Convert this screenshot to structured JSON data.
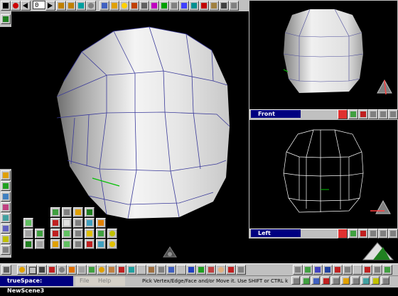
{
  "app": {
    "window_title": "trueSpace: NewScene3",
    "menu": [
      "File",
      "Help"
    ]
  },
  "toolbar": {
    "frame_value": "0"
  },
  "viewports": {
    "front_label": "Front",
    "left_label": "Left"
  },
  "status_text": "Pick Vertex/Edge/Face and/or Move it. Use SHIFT or CTRL key to add s",
  "colors": {
    "background": "#000000",
    "panel": "#c0c0c0",
    "title_bar": "#000080",
    "mesh_edges": "#3a3a9a",
    "selected_edge": "#00c000"
  },
  "icons": {
    "top_toolbar": [
      "stop-icon",
      "record-icon",
      "rewind-icon",
      "play-icon",
      "key-icon",
      "key-icon",
      "key-icon",
      "key-icon",
      "help-icon",
      "scene-icon",
      "eye-icon",
      "camera-icon",
      "light-icon",
      "render-icon",
      "object-icon",
      "material-icon",
      "paint-icon",
      "dots-icon",
      "grid-icon",
      "sync-icon",
      "undo-icon",
      "lock-icon",
      "view-icon",
      "arrow-icon",
      "delete-icon",
      "close-icon",
      "tool-icon",
      "tool-icon",
      "tool-icon",
      "tool-icon"
    ],
    "bottom_toolbar": [
      "object-tool-icon",
      "sphere-icon",
      "cube-icon",
      "cylinder-icon",
      "cone-icon",
      "torus-icon",
      "plane-icon",
      "text-icon",
      "paint-icon",
      "material-icon",
      "light-icon",
      "camera-icon",
      "render-icon",
      "deform-icon",
      "sweep-icon",
      "tip-icon",
      "lathe-icon",
      "bevel-icon",
      "smooth-icon",
      "boolean-icon",
      "grid-icon",
      "axis-icon",
      "nav-icon",
      "zoom-icon",
      "pan-icon",
      "rotate-icon",
      "scale-icon",
      "move-icon",
      "select-icon",
      "face-icon"
    ]
  }
}
